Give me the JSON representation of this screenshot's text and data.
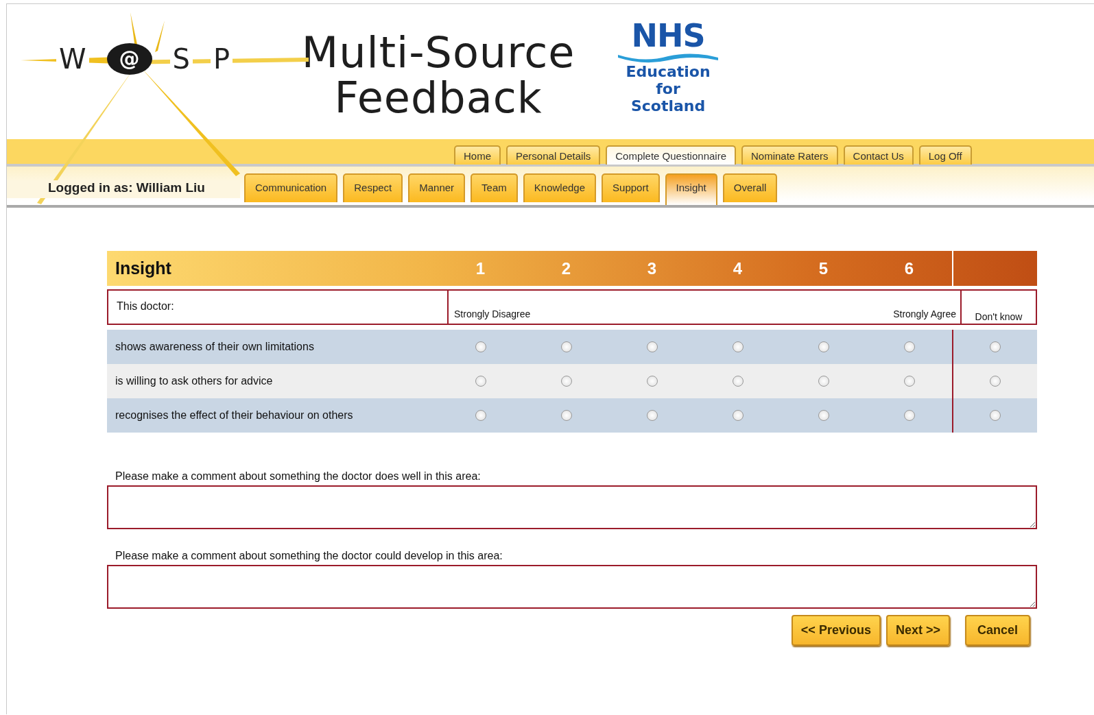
{
  "logo": {
    "letters": [
      "W",
      "@",
      "S",
      "P"
    ]
  },
  "title": {
    "line_1": "Multi-Source",
    "line_2": "Feedback"
  },
  "nhs_logo": {
    "mark": "NHS",
    "lines": [
      "Education",
      "for",
      "Scotland"
    ]
  },
  "main_tabs": [
    {
      "label": "Home",
      "selected": false
    },
    {
      "label": "Personal Details",
      "selected": false
    },
    {
      "label": "Complete Questionnaire",
      "selected": true
    },
    {
      "label": "Nominate Raters",
      "selected": false
    },
    {
      "label": "Contact Us",
      "selected": false
    },
    {
      "label": "Log Off",
      "selected": false
    }
  ],
  "logged_in": "Logged in as: William Liu",
  "section_tabs": [
    {
      "label": "Communication",
      "selected": false
    },
    {
      "label": "Respect",
      "selected": false
    },
    {
      "label": "Manner",
      "selected": false
    },
    {
      "label": "Team",
      "selected": false
    },
    {
      "label": "Knowledge",
      "selected": false
    },
    {
      "label": "Support",
      "selected": false
    },
    {
      "label": "Insight",
      "selected": true
    },
    {
      "label": "Overall",
      "selected": false
    }
  ],
  "questionnaire": {
    "title": "Insight",
    "scale": [
      "1",
      "2",
      "3",
      "4",
      "5",
      "6"
    ],
    "prompt": "This doctor:",
    "low_label": "Strongly Disagree",
    "high_label": "Strongly Agree",
    "dont_know": "Don't know",
    "rows": [
      {
        "statement": "shows awareness of their own limitations",
        "answers": [
          {
            "selected": false
          },
          {
            "selected": false
          },
          {
            "selected": false
          },
          {
            "selected": false
          },
          {
            "selected": false
          },
          {
            "selected": false
          },
          {
            "selected": false
          }
        ]
      },
      {
        "statement": "is willing to ask others for advice",
        "answers": [
          {
            "selected": false
          },
          {
            "selected": false
          },
          {
            "selected": false
          },
          {
            "selected": false
          },
          {
            "selected": false
          },
          {
            "selected": false
          },
          {
            "selected": false
          }
        ]
      },
      {
        "statement": "recognises the effect of their behaviour on others",
        "answers": [
          {
            "selected": false
          },
          {
            "selected": false
          },
          {
            "selected": false
          },
          {
            "selected": false
          },
          {
            "selected": false
          },
          {
            "selected": false
          },
          {
            "selected": false
          }
        ]
      }
    ]
  },
  "comments": [
    {
      "label": "Please make a comment about something the doctor does well in this area:"
    },
    {
      "label": "Please make a comment about something the doctor could develop in this area:"
    }
  ],
  "buttons": [
    "<< Previous",
    "Next >>",
    "Cancel"
  ]
}
